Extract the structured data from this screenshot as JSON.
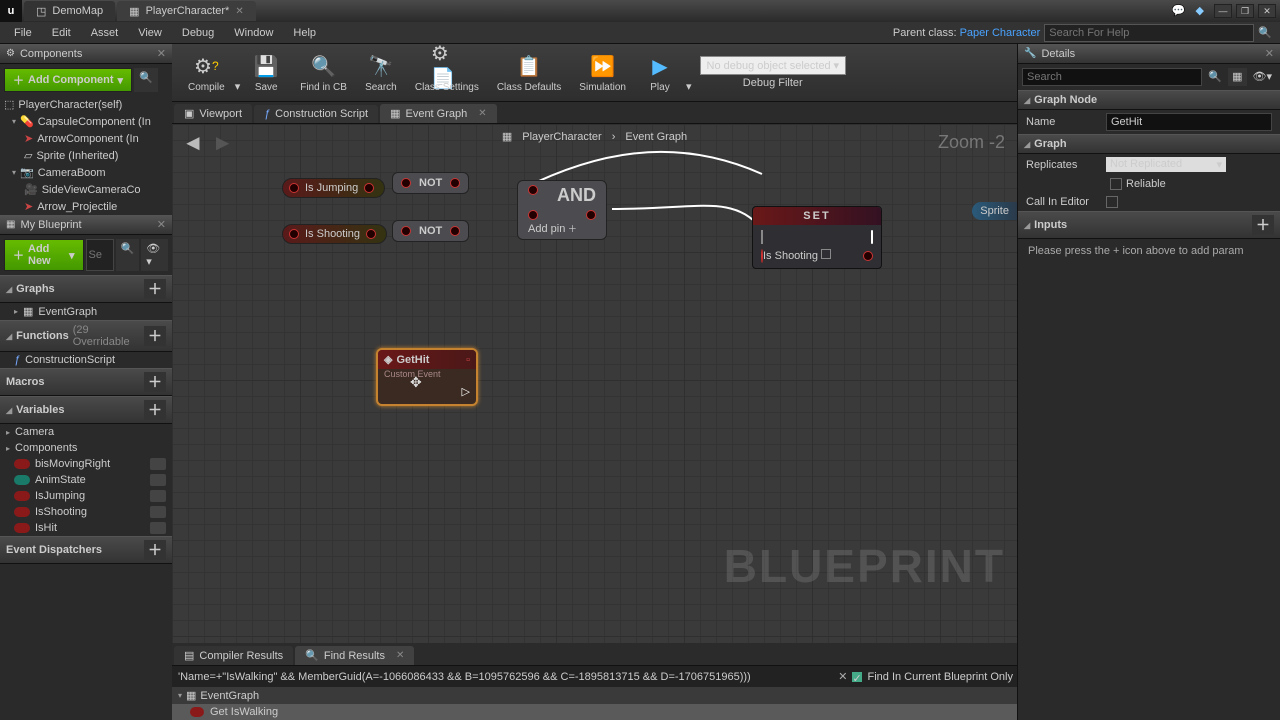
{
  "titlebar": {
    "tab1": "DemoMap",
    "tab2": "PlayerCharacter*"
  },
  "menu": {
    "file": "File",
    "edit": "Edit",
    "asset": "Asset",
    "view": "View",
    "debug": "Debug",
    "window": "Window",
    "help": "Help",
    "parent_label": "Parent class:",
    "parent_value": "Paper Character",
    "search_placeholder": "Search For Help"
  },
  "components": {
    "title": "Components",
    "add": "Add Component",
    "items": [
      "PlayerCharacter(self)",
      "CapsuleComponent (In",
      "ArrowComponent (In",
      "Sprite (Inherited)",
      "CameraBoom",
      "SideViewCameraCo",
      "Arrow_Projectile"
    ]
  },
  "mybp": {
    "title": "My Blueprint",
    "add": "Add New",
    "search_ph": "Se",
    "graphs": "Graphs",
    "eventgraph": "EventGraph",
    "functions": "Functions",
    "functions_note": "(29 Overridable",
    "construction": "ConstructionScript",
    "macros": "Macros",
    "variables": "Variables",
    "cat_camera": "Camera",
    "cat_components": "Components",
    "vars": [
      "bisMovingRight",
      "AnimState",
      "IsJumping",
      "IsShooting",
      "IsHit"
    ],
    "dispatchers": "Event Dispatchers"
  },
  "toolbar": {
    "compile": "Compile",
    "save": "Save",
    "find": "Find in CB",
    "search": "Search",
    "class_settings": "Class Settings",
    "class_defaults": "Class Defaults",
    "simulation": "Simulation",
    "play": "Play",
    "debug_sel": "No debug object selected",
    "debug_filter": "Debug Filter"
  },
  "graph_tabs": {
    "viewport": "Viewport",
    "construction": "Construction Script",
    "event": "Event Graph"
  },
  "breadcrumb": {
    "a": "PlayerCharacter",
    "b": "Event Graph"
  },
  "zoom": "Zoom -2",
  "nodes": {
    "isjumping": "Is Jumping",
    "isshooting": "Is Shooting",
    "not": "NOT",
    "and": "AND",
    "addpin": "Add pin",
    "set": "SET",
    "set_var": "Is Shooting",
    "gethit": "GetHit",
    "gethit_sub": "Custom Event",
    "sprite": "Sprite"
  },
  "watermark": "BLUEPRINT",
  "bottom_tabs": {
    "compiler": "Compiler Results",
    "find": "Find Results"
  },
  "search": {
    "text": "'Name=+\"IsWalking\" && MemberGuid(A=-1066086433 && B=1095762596 && C=-1895813715 && D=-1706751965)))",
    "only": "Find In Current Blueprint Only",
    "res_hdr": "EventGraph",
    "res_row": "Get IsWalking"
  },
  "details": {
    "title": "Details",
    "search_ph": "Search",
    "sect_graph": "Graph Node",
    "name_lbl": "Name",
    "name_val": "GetHit",
    "sect_graph2": "Graph",
    "replicates": "Replicates",
    "rep_val": "Not Replicated",
    "reliable": "Reliable",
    "cie": "Call In Editor",
    "sect_inputs": "Inputs",
    "inputs_msg": "Please press the + icon above to add param"
  }
}
